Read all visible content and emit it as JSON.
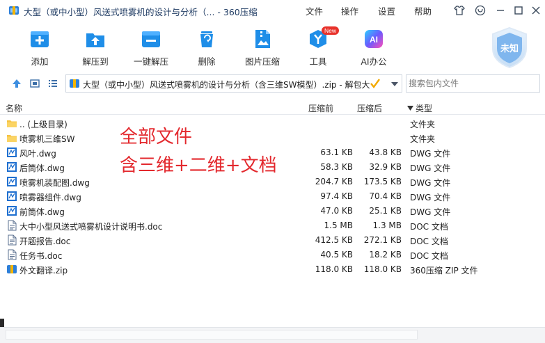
{
  "window": {
    "title": "大型（或中小型）风送式喷雾机的设计与分析（... - 360压缩",
    "menu": [
      "文件",
      "操作",
      "设置",
      "帮助"
    ]
  },
  "toolbar": {
    "items": [
      {
        "label": "添加",
        "icon": "add-icon"
      },
      {
        "label": "解压到",
        "icon": "extract-to-icon"
      },
      {
        "label": "一键解压",
        "icon": "one-click-extract-icon"
      },
      {
        "label": "删除",
        "icon": "delete-icon"
      },
      {
        "label": "图片压缩",
        "icon": "image-compress-icon"
      },
      {
        "label": "工具",
        "icon": "tools-icon",
        "badge": "New"
      },
      {
        "label": "AI办公",
        "icon": "ai-office-icon",
        "badge_text": "AI"
      }
    ],
    "shield_label": "未知"
  },
  "pathbar": {
    "path": "大型（或中小型）风送式喷雾机的设计与分析（含三维SW模型）.zip - 解包大",
    "search_placeholder": "搜索包内文件"
  },
  "columns": {
    "name": "名称",
    "packed": "压缩前",
    "size": "压缩后",
    "type": "类型"
  },
  "files": [
    {
      "name": ".. (上级目录)",
      "packed": "",
      "size": "",
      "type": "文件夹",
      "icon": "folder-icon"
    },
    {
      "name": "喷雾机三维SW",
      "packed": "",
      "size": "",
      "type": "文件夹",
      "icon": "folder-icon"
    },
    {
      "name": "风叶.dwg",
      "packed": "63.1 KB",
      "size": "43.8 KB",
      "type": "DWG 文件",
      "icon": "dwg-file-icon"
    },
    {
      "name": "后筒体.dwg",
      "packed": "58.3 KB",
      "size": "32.9 KB",
      "type": "DWG 文件",
      "icon": "dwg-file-icon"
    },
    {
      "name": "喷雾机装配图.dwg",
      "packed": "204.7 KB",
      "size": "173.5 KB",
      "type": "DWG 文件",
      "icon": "dwg-file-icon"
    },
    {
      "name": "喷雾器组件.dwg",
      "packed": "97.4 KB",
      "size": "70.4 KB",
      "type": "DWG 文件",
      "icon": "dwg-file-icon"
    },
    {
      "name": "前筒体.dwg",
      "packed": "47.0 KB",
      "size": "25.1 KB",
      "type": "DWG 文件",
      "icon": "dwg-file-icon"
    },
    {
      "name": "大中小型风送式喷雾机设计说明书.doc",
      "packed": "1.5 MB",
      "size": "1.3 MB",
      "type": "DOC 文档",
      "icon": "doc-file-icon"
    },
    {
      "name": "开题报告.doc",
      "packed": "412.5 KB",
      "size": "272.1 KB",
      "type": "DOC 文档",
      "icon": "doc-file-icon"
    },
    {
      "name": "任务书.doc",
      "packed": "40.5 KB",
      "size": "18.2 KB",
      "type": "DOC 文档",
      "icon": "doc-file-icon"
    },
    {
      "name": "外文翻译.zip",
      "packed": "118.0 KB",
      "size": "118.0 KB",
      "type": "360压缩 ZIP 文件",
      "icon": "zip-file-icon"
    }
  ],
  "overlay": {
    "line1": "全部文件",
    "line2": "含三维+二维+文档"
  },
  "colors": {
    "accent": "#1f8ee8",
    "overlay_red": "#e3282d",
    "folder": "#f6c343"
  }
}
